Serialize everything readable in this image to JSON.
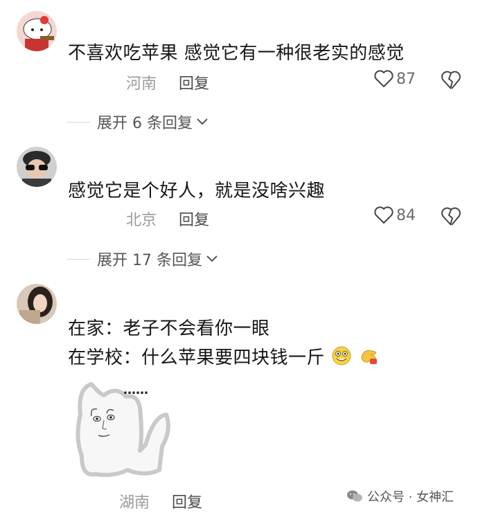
{
  "comments": [
    {
      "text": "不喜欢吃苹果 感觉它有一种很老实的感觉",
      "location": "河南",
      "reply_label": "回复",
      "likes": "87",
      "expand_label": "展开 6 条回复"
    },
    {
      "text": "感觉它是个好人，就是没啥兴趣",
      "location": "北京",
      "reply_label": "回复",
      "likes": "84",
      "expand_label": "展开 17 条回复"
    },
    {
      "line1": "在家：老子不会看你一眼",
      "line2": "在学校：什么苹果要四块钱一斤",
      "sticker_text": "……",
      "location": "湖南",
      "reply_label": "回复"
    }
  ],
  "watermark": "公众号 · 女神汇",
  "icons": {
    "like": "heart-outline-icon",
    "dislike": "broken-heart-icon",
    "expand": "chevron-down-icon",
    "emoji_1": "grin-emoji-icon",
    "emoji_2": "hand-emoji-icon",
    "watermark": "wechat-icon"
  }
}
